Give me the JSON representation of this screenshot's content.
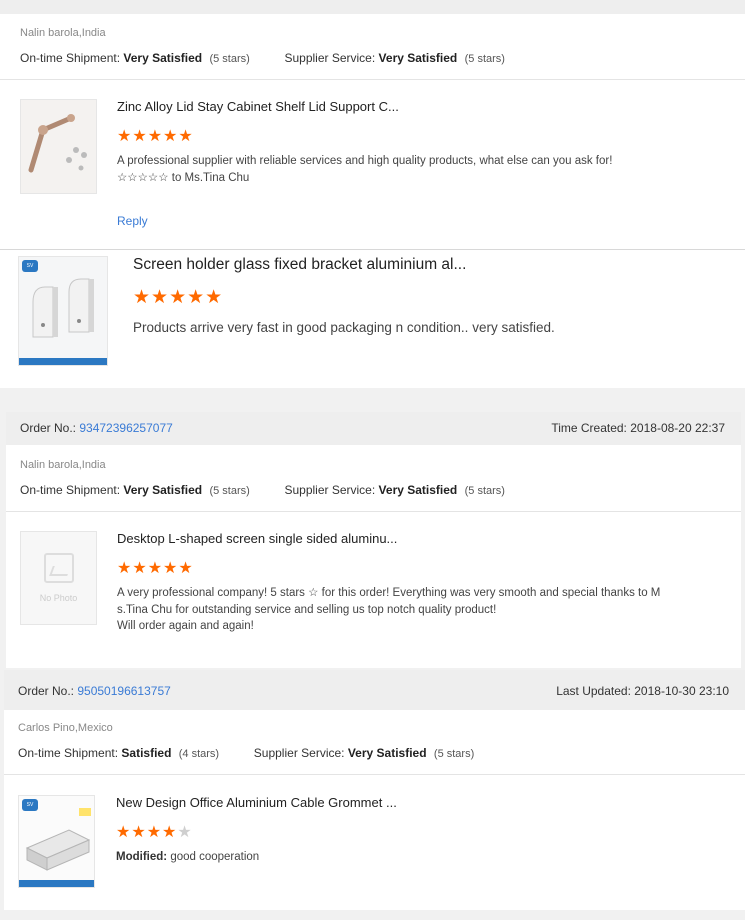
{
  "order0": {
    "buyer": "Nalin barola,India",
    "shipment_label": "On-time Shipment:",
    "shipment_value": "Very Satisfied",
    "shipment_count": "(5 stars)",
    "service_label": "Supplier Service:",
    "service_value": "Very Satisfied",
    "service_count": "(5 stars)",
    "reviews": [
      {
        "product": "Zinc Alloy Lid Stay Cabinet Shelf Lid Support C...",
        "rating": 5,
        "stars": "★★★★★",
        "text_line1": "A professional supplier with reliable services and high quality products, what else can you ask for!",
        "text_line2": "☆☆☆☆☆ to Ms.Tina Chu",
        "reply": "Reply"
      },
      {
        "product": "Screen holder glass fixed bracket aluminium al...",
        "rating": 5,
        "stars": "★★★★★",
        "text": "Products arrive very fast in good packaging n condition.. very satisfied."
      }
    ]
  },
  "order1": {
    "order_label": "Order No.:",
    "order_number": "93472396257077",
    "time_label": "Time Created:",
    "time_value": "2018-08-20 22:37",
    "buyer": "Nalin barola,India",
    "shipment_label": "On-time Shipment:",
    "shipment_value": "Very Satisfied",
    "shipment_count": "(5 stars)",
    "service_label": "Supplier Service:",
    "service_value": "Very Satisfied",
    "service_count": "(5 stars)",
    "review": {
      "product": "Desktop L-shaped screen single sided aluminu...",
      "no_photo": "No Photo",
      "rating": 5,
      "stars": "★★★★★",
      "text_line1": "A very professional company! 5 stars ☆ for this order! Everything was very smooth and special thanks to M",
      "text_line2": "s.Tina Chu for outstanding service and selling us top notch quality product!",
      "text_line3": "Will order again and again!"
    }
  },
  "order2": {
    "order_label": "Order No.:",
    "order_number": "95050196613757",
    "time_label": "Last Updated:",
    "time_value": "2018-10-30 23:10",
    "buyer": "Carlos Pino,Mexico",
    "shipment_label": "On-time Shipment:",
    "shipment_value": "Satisfied",
    "shipment_count": "(4 stars)",
    "service_label": "Supplier Service:",
    "service_value": "Very Satisfied",
    "service_count": "(5 stars)",
    "review": {
      "product": "New Design Office Aluminium Cable Grommet ...",
      "rating": 4,
      "stars_on": "★★★★",
      "stars_off": "★",
      "modified_label": "Modified:",
      "modified_text": "good cooperation"
    }
  },
  "colors": {
    "accent": "#ff6a00",
    "link": "#3a7bd5",
    "header_bg": "#eeeeee"
  }
}
